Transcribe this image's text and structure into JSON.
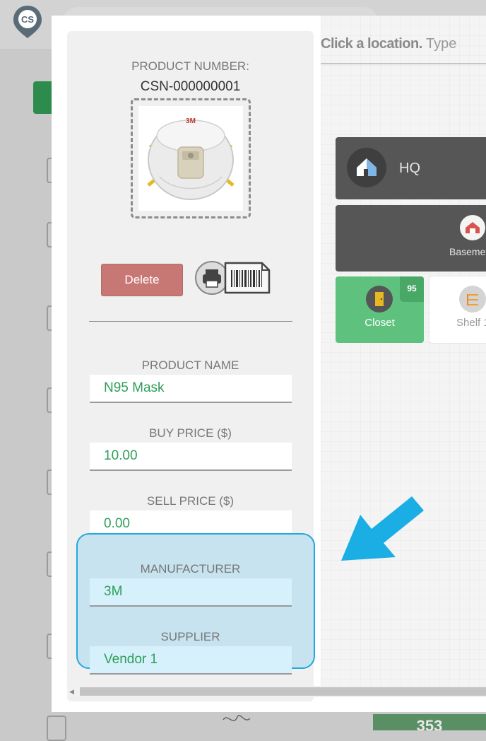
{
  "app": {
    "logo_text": "CS",
    "bottom_card_value": "353"
  },
  "product": {
    "number_label": "PRODUCT NUMBER:",
    "number_value": "CSN-000000001",
    "image_alt": "N95 respirator mask",
    "delete_label": "Delete"
  },
  "fields": {
    "product_name": {
      "label": "PRODUCT NAME",
      "value": "N95 Mask"
    },
    "buy_price": {
      "label": "BUY PRICE ($)",
      "value": "10.00"
    },
    "sell_price": {
      "label": "SELL PRICE ($)",
      "value": "0.00"
    },
    "manufacturer": {
      "label": "MANUFACTURER",
      "value": "3M"
    },
    "supplier": {
      "label": "SUPPLIER",
      "value": "Vendor 1"
    }
  },
  "locations": {
    "prompt_strong": "Click a location.",
    "prompt_rest": " Type",
    "hq_label": "HQ",
    "basement_label": "Baseme",
    "closet_label": "Closet",
    "closet_count": "95",
    "shelf_label": "Shelf 1"
  },
  "colors": {
    "highlight_border": "#23a8df",
    "field_text": "#2e9e5a",
    "delete_button": "#c87874",
    "closet_green": "#5ec27e",
    "arrow": "#1aaee5"
  },
  "icons": {
    "print": "printer-icon",
    "barcode": "barcode-label-icon",
    "hq": "house-icon",
    "basement": "basement-house-icon",
    "closet": "door-icon",
    "shelf": "shelf-icon"
  }
}
